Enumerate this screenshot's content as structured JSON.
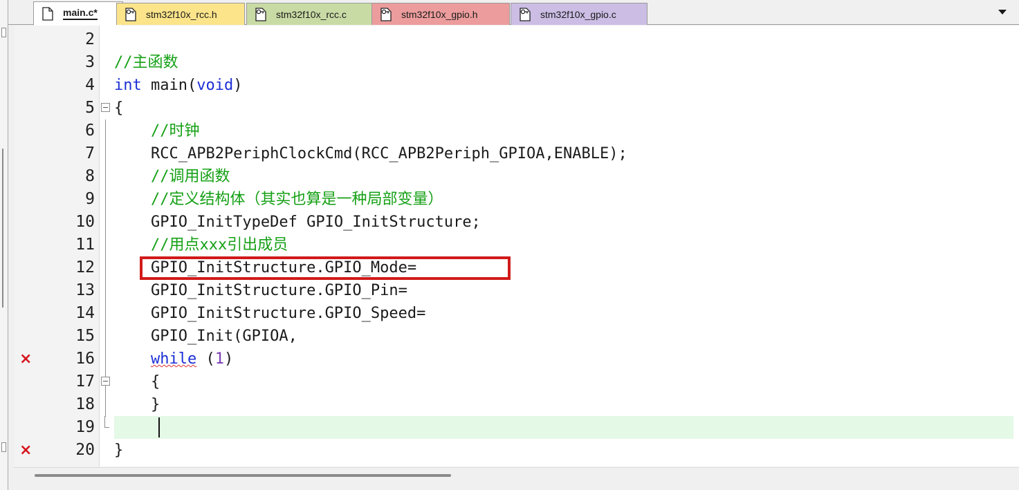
{
  "tabs": [
    {
      "label": "main.c*",
      "bg": "#ffffff",
      "active": true
    },
    {
      "label": "stm32f10x_rcc.h",
      "bg": "#fbe48a",
      "active": false
    },
    {
      "label": "stm32f10x_rcc.c",
      "bg": "#c9dba5",
      "active": false
    },
    {
      "label": "stm32f10x_gpio.h",
      "bg": "#ec9c9c",
      "active": false
    },
    {
      "label": "stm32f10x_gpio.c",
      "bg": "#cbbde4",
      "active": false
    }
  ],
  "editor": {
    "lines": [
      {
        "num": "2",
        "text": ""
      },
      {
        "num": "3",
        "text": "//主函数"
      },
      {
        "num": "4",
        "kw1": "int",
        "text": " main(",
        "kw2": "void",
        "text2": ")"
      },
      {
        "num": "5",
        "text": "{"
      },
      {
        "num": "6",
        "text": "    //时钟"
      },
      {
        "num": "7",
        "text": "    RCC_APB2PeriphClockCmd(RCC_APB2Periph_GPIOA,ENABLE);"
      },
      {
        "num": "8",
        "text": "    //调用函数"
      },
      {
        "num": "9",
        "text": "    //定义结构体（其实也算是一种局部变量）"
      },
      {
        "num": "10",
        "text": "    GPIO_InitTypeDef GPIO_InitStructure;"
      },
      {
        "num": "11",
        "text": "    //用点xxx引出成员"
      },
      {
        "num": "12",
        "text": "    GPIO_InitStructure.GPIO_Mode="
      },
      {
        "num": "13",
        "text": "    GPIO_InitStructure.GPIO_Pin="
      },
      {
        "num": "14",
        "text": "    GPIO_InitStructure.GPIO_Speed="
      },
      {
        "num": "15",
        "text": "    GPIO_Init(GPIOA,"
      },
      {
        "num": "16",
        "kw1": "while",
        "text": " (",
        "val": "1",
        "text2": ")"
      },
      {
        "num": "17",
        "text": "    {"
      },
      {
        "num": "18",
        "text": "    }"
      },
      {
        "num": "19",
        "text": ""
      },
      {
        "num": "20",
        "text": "}"
      }
    ],
    "error_mark": "×",
    "colors": {
      "keyword": "#1c2fd6",
      "comment": "#15a015",
      "number": "#7a3bb4",
      "error": "#d6141c",
      "highlight_box": "#d11a1a",
      "current_line": "#e4f9e6"
    }
  }
}
